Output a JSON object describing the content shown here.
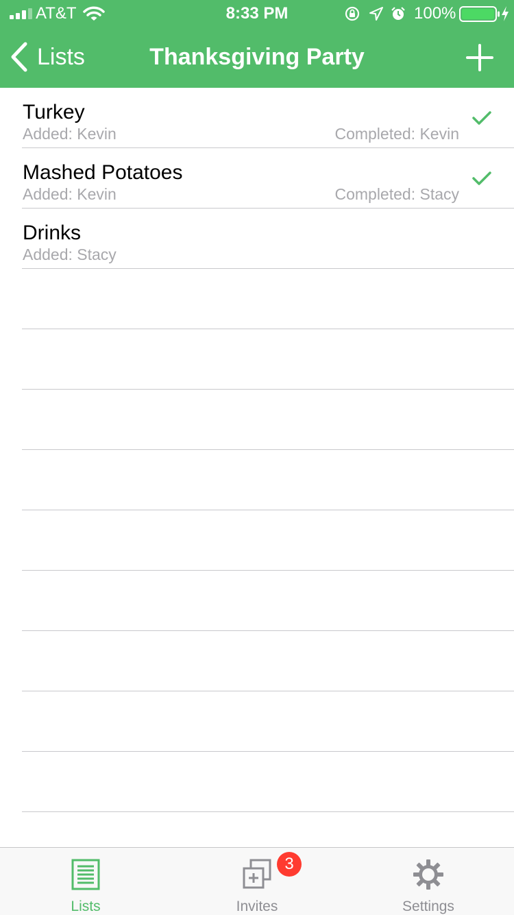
{
  "status_bar": {
    "carrier": "AT&T",
    "time": "8:33 PM",
    "battery_percent": "100%",
    "signal_bars": 3,
    "icons": [
      "signal-icon",
      "wifi-icon",
      "orientation-lock-icon",
      "location-arrow-icon",
      "alarm-icon",
      "battery-icon",
      "charging-bolt-icon"
    ]
  },
  "nav": {
    "back_label": "Lists",
    "title": "Thanksgiving Party",
    "add_icon": "plus-icon"
  },
  "items": [
    {
      "title": "Turkey",
      "added": "Added: Kevin",
      "completed": "Completed: Kevin",
      "done": true
    },
    {
      "title": "Mashed Potatoes",
      "added": "Added: Kevin",
      "completed": "Completed: Stacy",
      "done": true
    },
    {
      "title": "Drinks",
      "added": "Added: Stacy",
      "completed": "",
      "done": false
    }
  ],
  "tabs": [
    {
      "label": "Lists",
      "icon": "list-icon",
      "active": true
    },
    {
      "label": "Invites",
      "icon": "invites-icon",
      "badge": "3",
      "active": false
    },
    {
      "label": "Settings",
      "icon": "gear-icon",
      "active": false
    }
  ],
  "colors": {
    "accent": "#52bc6a",
    "badge": "#ff3b30",
    "secondary_text": "#a8a8ac",
    "inactive_tab": "#8e8e93"
  }
}
